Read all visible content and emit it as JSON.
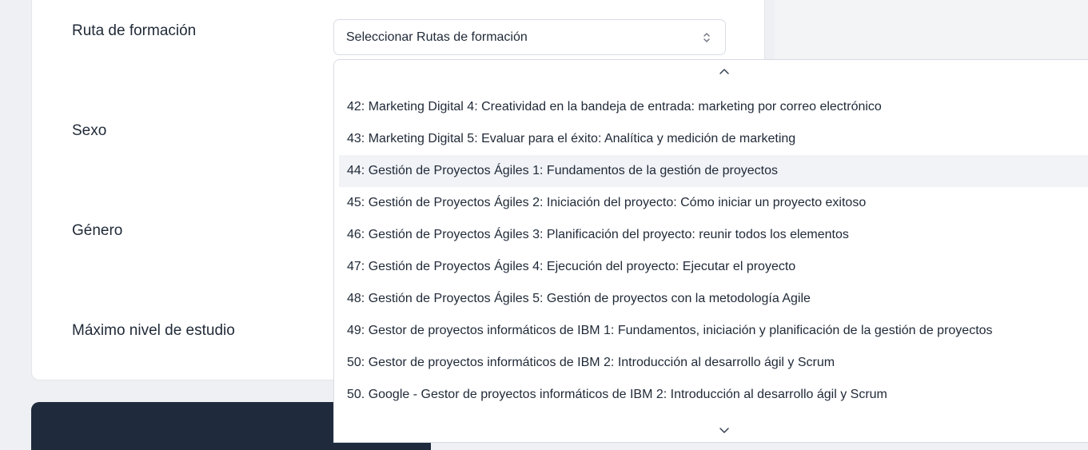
{
  "form": {
    "ruta_label": "Ruta de formación",
    "sexo_label": "Sexo",
    "genero_label": "Género",
    "nivel_label": "Máximo nivel de estudio",
    "ruta_select_value": "Seleccionar Rutas de formación"
  },
  "dropdown": {
    "highlighted_index": 2,
    "options": [
      "42: Marketing Digital 4: Creatividad en la bandeja de entrada: marketing por correo electrónico",
      "43: Marketing Digital 5: Evaluar para el éxito: Analítica y medición de marketing",
      "44: Gestión de Proyectos Ágiles 1: Fundamentos de la gestión de proyectos",
      "45: Gestión de Proyectos Ágiles 2: Iniciación del proyecto: Cómo iniciar un proyecto exitoso",
      "46: Gestión de Proyectos Ágiles 3: Planificación del proyecto: reunir todos los elementos",
      "47: Gestión de Proyectos Ágiles 4: Ejecución del proyecto: Ejecutar el proyecto",
      "48: Gestión de Proyectos Ágiles 5: Gestión de proyectos con la metodología Agile",
      "49: Gestor de proyectos informáticos de IBM 1: Fundamentos, iniciación y planificación de la gestión de proyectos",
      "50: Gestor de proyectos informáticos de IBM 2: Introducción al desarrollo ágil y Scrum",
      "50. Google - Gestor de proyectos informáticos de IBM 2: Introducción al desarrollo ágil y Scrum"
    ]
  },
  "icons": {
    "select_icon": "chevron-up-down-icon",
    "scroll_up": "chevron-up-icon",
    "scroll_down": "chevron-down-icon"
  }
}
